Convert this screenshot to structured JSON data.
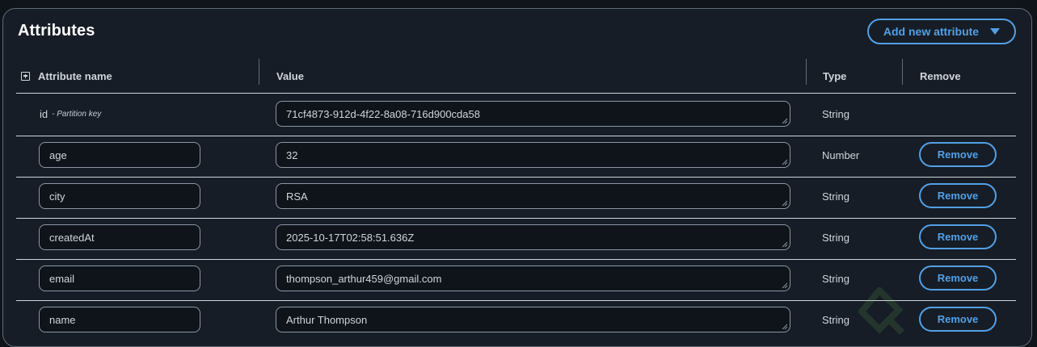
{
  "panel": {
    "title": "Attributes",
    "add_button_label": "Add new attribute"
  },
  "columns": {
    "name": "Attribute name",
    "value": "Value",
    "type": "Type",
    "remove": "Remove"
  },
  "partition_key": {
    "name": "id",
    "note": "- Partition key",
    "value": "71cf4873-912d-4f22-8a08-716d900cda58",
    "type": "String"
  },
  "rows": [
    {
      "name": "age",
      "value": "32",
      "type": "Number",
      "remove_label": "Remove"
    },
    {
      "name": "city",
      "value": "RSA",
      "type": "String",
      "remove_label": "Remove"
    },
    {
      "name": "createdAt",
      "value": "2025-10-17T02:58:51.636Z",
      "type": "String",
      "remove_label": "Remove"
    },
    {
      "name": "email",
      "value": "thompson_arthur459@gmail.com",
      "type": "String",
      "remove_label": "Remove"
    },
    {
      "name": "name",
      "value": "Arthur Thompson",
      "type": "String",
      "remove_label": "Remove"
    }
  ],
  "colors": {
    "background": "#161d26",
    "accent": "#539fe5",
    "border": "#8c96a3"
  }
}
